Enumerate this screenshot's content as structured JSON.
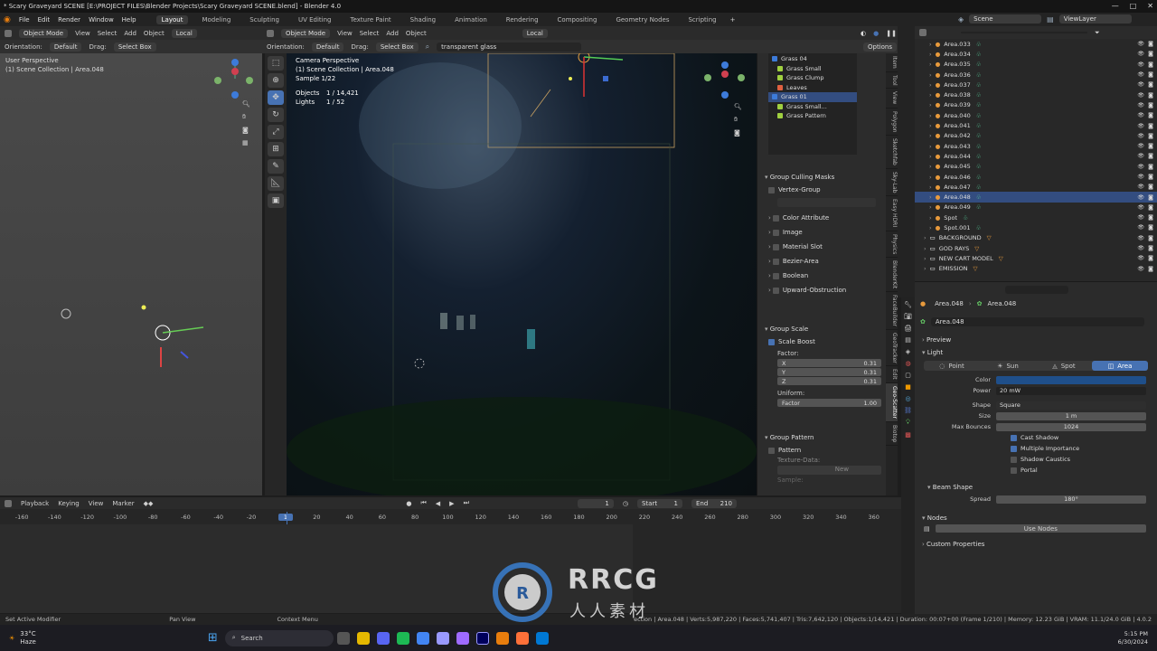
{
  "titlebar": {
    "title": "* Scary Graveyard SCENE [E:\\PROJECT FILES\\Blender Projects\\Scary Graveyard SCENE.blend] - Blender 4.0"
  },
  "menu": [
    "File",
    "Edit",
    "Render",
    "Window",
    "Help"
  ],
  "workspaces": [
    "Layout",
    "Modeling",
    "Sculpting",
    "UV Editing",
    "Texture Paint",
    "Shading",
    "Animation",
    "Rendering",
    "Compositing",
    "Geometry Nodes",
    "Scripting"
  ],
  "scene": {
    "scene": "Scene",
    "view_layer": "ViewLayer"
  },
  "left_viewport": {
    "mode": "Object Mode",
    "menus": [
      "View",
      "Select",
      "Add",
      "Object"
    ],
    "transform": "Local",
    "orientation_label": "Orientation:",
    "orientation": "Default",
    "drag_label": "Drag:",
    "drag": "Select Box",
    "overlay": "User Perspective",
    "collection": "(1) Scene Collection | Area.048"
  },
  "cam_viewport": {
    "mode": "Object Mode",
    "menus": [
      "View",
      "Select",
      "Add",
      "Object"
    ],
    "transform": "Local",
    "orientation_label": "Orientation:",
    "orientation": "Default",
    "drag_label": "Drag:",
    "drag": "Select Box",
    "search": "transparent glass",
    "options": "Options",
    "line1": "Camera Perspective",
    "line2": "(1) Scene Collection | Area.048",
    "line3": "Sample 1/22",
    "objects_label": "Objects",
    "objects_value": "1 / 14,421",
    "lights_label": "Lights",
    "lights_value": "1 / 52"
  },
  "npanel": {
    "tree": [
      {
        "name": "Grass 04",
        "sel": false
      },
      {
        "name": "Grass Small",
        "sel": false
      },
      {
        "name": "Grass Clump",
        "sel": false
      },
      {
        "name": "Leaves",
        "sel": false
      },
      {
        "name": "Grass 01",
        "sel": true
      },
      {
        "name": "Grass Small...",
        "sel": false
      },
      {
        "name": "Grass Pattern",
        "sel": false
      }
    ],
    "culling": "Group Culling Masks",
    "vertex_group": "Vertex-Group",
    "masks": [
      "Color Attribute",
      "Image",
      "Material Slot",
      "Bezier-Area",
      "Boolean",
      "Upward-Obstruction"
    ],
    "scale": "Group Scale",
    "scale_boost": "Scale Boost",
    "factor": "Factor:",
    "xyz": [
      {
        "k": "X",
        "v": "0.31"
      },
      {
        "k": "Y",
        "v": "0.31"
      },
      {
        "k": "Z",
        "v": "0.31"
      }
    ],
    "uniform": "Uniform:",
    "uniform_factor": {
      "k": "Factor",
      "v": "1.00"
    },
    "pattern": "Group Pattern",
    "pattern_chk": "Pattern",
    "texture_data": "Texture-Data:",
    "new_btn": "New",
    "sample": "Sample:"
  },
  "ntabs": [
    "Item",
    "Tool",
    "View",
    "Polygon",
    "Sketchfab",
    "Sky-Lab",
    "Easy HDRI",
    "Physics",
    "BlenderKit",
    "FaceBuilder",
    "GeoTracker",
    "Edit",
    "Geo-Scatter",
    "Biotop"
  ],
  "outliner": [
    {
      "name": "Area.033",
      "sel": false,
      "type": "lamp"
    },
    {
      "name": "Area.034",
      "sel": false,
      "type": "lamp"
    },
    {
      "name": "Area.035",
      "sel": false,
      "type": "lamp"
    },
    {
      "name": "Area.036",
      "sel": false,
      "type": "lamp"
    },
    {
      "name": "Area.037",
      "sel": false,
      "type": "lamp"
    },
    {
      "name": "Area.038",
      "sel": false,
      "type": "lamp"
    },
    {
      "name": "Area.039",
      "sel": false,
      "type": "lamp"
    },
    {
      "name": "Area.040",
      "sel": false,
      "type": "lamp"
    },
    {
      "name": "Area.041",
      "sel": false,
      "type": "lamp"
    },
    {
      "name": "Area.042",
      "sel": false,
      "type": "lamp"
    },
    {
      "name": "Area.043",
      "sel": false,
      "type": "lamp"
    },
    {
      "name": "Area.044",
      "sel": false,
      "type": "lamp"
    },
    {
      "name": "Area.045",
      "sel": false,
      "type": "lamp"
    },
    {
      "name": "Area.046",
      "sel": false,
      "type": "lamp"
    },
    {
      "name": "Area.047",
      "sel": false,
      "type": "lamp"
    },
    {
      "name": "Area.048",
      "sel": true,
      "type": "lamp"
    },
    {
      "name": "Area.049",
      "sel": false,
      "type": "lamp"
    },
    {
      "name": "Spot",
      "sel": false,
      "type": "lamp"
    },
    {
      "name": "Spot.001",
      "sel": false,
      "type": "lamp"
    },
    {
      "name": "BACKGROUND",
      "sel": false,
      "type": "coll"
    },
    {
      "name": "GOD RAYS",
      "sel": false,
      "type": "coll"
    },
    {
      "name": "NEW CART MODEL",
      "sel": false,
      "type": "coll"
    },
    {
      "name": "EMISSION",
      "sel": false,
      "type": "coll"
    }
  ],
  "props": {
    "breadcrumb_obj": "Area.048",
    "breadcrumb_data": "Area.048",
    "datablock": "Area.048",
    "preview": "Preview",
    "light": "Light",
    "types": [
      "Point",
      "Sun",
      "Spot",
      "Area"
    ],
    "active_type": "Area",
    "color_label": "Color",
    "power_label": "Power",
    "power": "20 mW",
    "shape_label": "Shape",
    "shape": "Square",
    "size_label": "Size",
    "size": "1 m",
    "max_bounces_label": "Max Bounces",
    "max_bounces": "1024",
    "checks": [
      {
        "label": "Cast Shadow",
        "on": true
      },
      {
        "label": "Multiple Importance",
        "on": true
      },
      {
        "label": "Shadow Caustics",
        "on": false
      },
      {
        "label": "Portal",
        "on": false
      }
    ],
    "beam_shape": "Beam Shape",
    "spread_label": "Spread",
    "spread": "180°",
    "nodes": "Nodes",
    "use_nodes": "Use Nodes",
    "custom_props": "Custom Properties",
    "light_color": "#1f4f8a"
  },
  "timeline": {
    "menus": [
      "Playback",
      "Keying",
      "View",
      "Marker"
    ],
    "current": "1",
    "start_label": "Start",
    "start": "1",
    "end_label": "End",
    "end": "210",
    "ticks": [
      "-160",
      "-140",
      "-120",
      "-100",
      "-80",
      "-60",
      "-40",
      "-20",
      "1",
      "20",
      "40",
      "60",
      "80",
      "100",
      "120",
      "140",
      "160",
      "180",
      "200",
      "220",
      "240",
      "260",
      "280",
      "300",
      "320",
      "340",
      "360"
    ]
  },
  "status": {
    "left": "Set Active Modifier",
    "mid": "Pan View",
    "ctx": "Context Menu",
    "stats": "ection | Area.048 | Verts:5,987,220 | Faces:5,741,407 | Tris:7,642,120 | Objects:1/14,421 | Duration: 00:07+00 (Frame 1/210) | Memory: 12.23 GiB | VRAM: 11.1/24.0 GiB | 4.0.2"
  },
  "taskbar": {
    "temp": "33°C",
    "weather": "Haze",
    "search": "Search",
    "time": "5:15 PM",
    "date": "6/30/2024"
  },
  "watermark": {
    "brand": "RRCG",
    "sub": "人人素材"
  }
}
